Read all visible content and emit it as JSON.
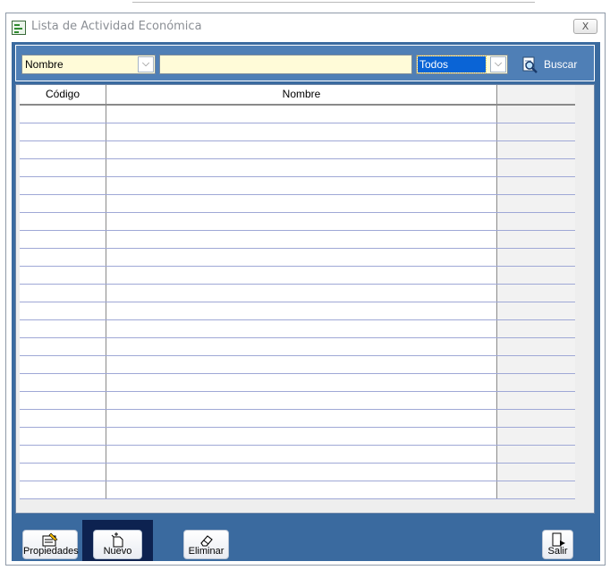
{
  "window": {
    "title": "Lista de Actividad Económica",
    "close_glyph": "X"
  },
  "toolbar": {
    "field_select_value": "Nombre",
    "search_value": "",
    "filter_select_value": "Todos",
    "buscar_label": "Buscar",
    "buscar_icon": "search-icon"
  },
  "grid": {
    "columns": [
      "Código",
      "Nombre",
      ""
    ],
    "rows": [
      [
        "",
        "",
        ""
      ],
      [
        "",
        "",
        ""
      ],
      [
        "",
        "",
        ""
      ],
      [
        "",
        "",
        ""
      ],
      [
        "",
        "",
        ""
      ],
      [
        "",
        "",
        ""
      ],
      [
        "",
        "",
        ""
      ],
      [
        "",
        "",
        ""
      ],
      [
        "",
        "",
        ""
      ],
      [
        "",
        "",
        ""
      ],
      [
        "",
        "",
        ""
      ],
      [
        "",
        "",
        ""
      ],
      [
        "",
        "",
        ""
      ],
      [
        "",
        "",
        ""
      ],
      [
        "",
        "",
        ""
      ],
      [
        "",
        "",
        ""
      ],
      [
        "",
        "",
        ""
      ],
      [
        "",
        "",
        ""
      ],
      [
        "",
        "",
        ""
      ],
      [
        "",
        "",
        ""
      ],
      [
        "",
        "",
        ""
      ],
      [
        "",
        "",
        ""
      ]
    ]
  },
  "actions": {
    "propiedades_label": "Propiedades",
    "nuevo_label": "Nuevo",
    "eliminar_label": "Eliminar",
    "salir_label": "Salir"
  },
  "colors": {
    "panel_blue": "#3a6a9f",
    "toolbar_blue": "#4f7fb6",
    "input_yellow": "#fffbd8",
    "selection_blue": "#0a64d6",
    "focus_frame": "#0d2250"
  }
}
